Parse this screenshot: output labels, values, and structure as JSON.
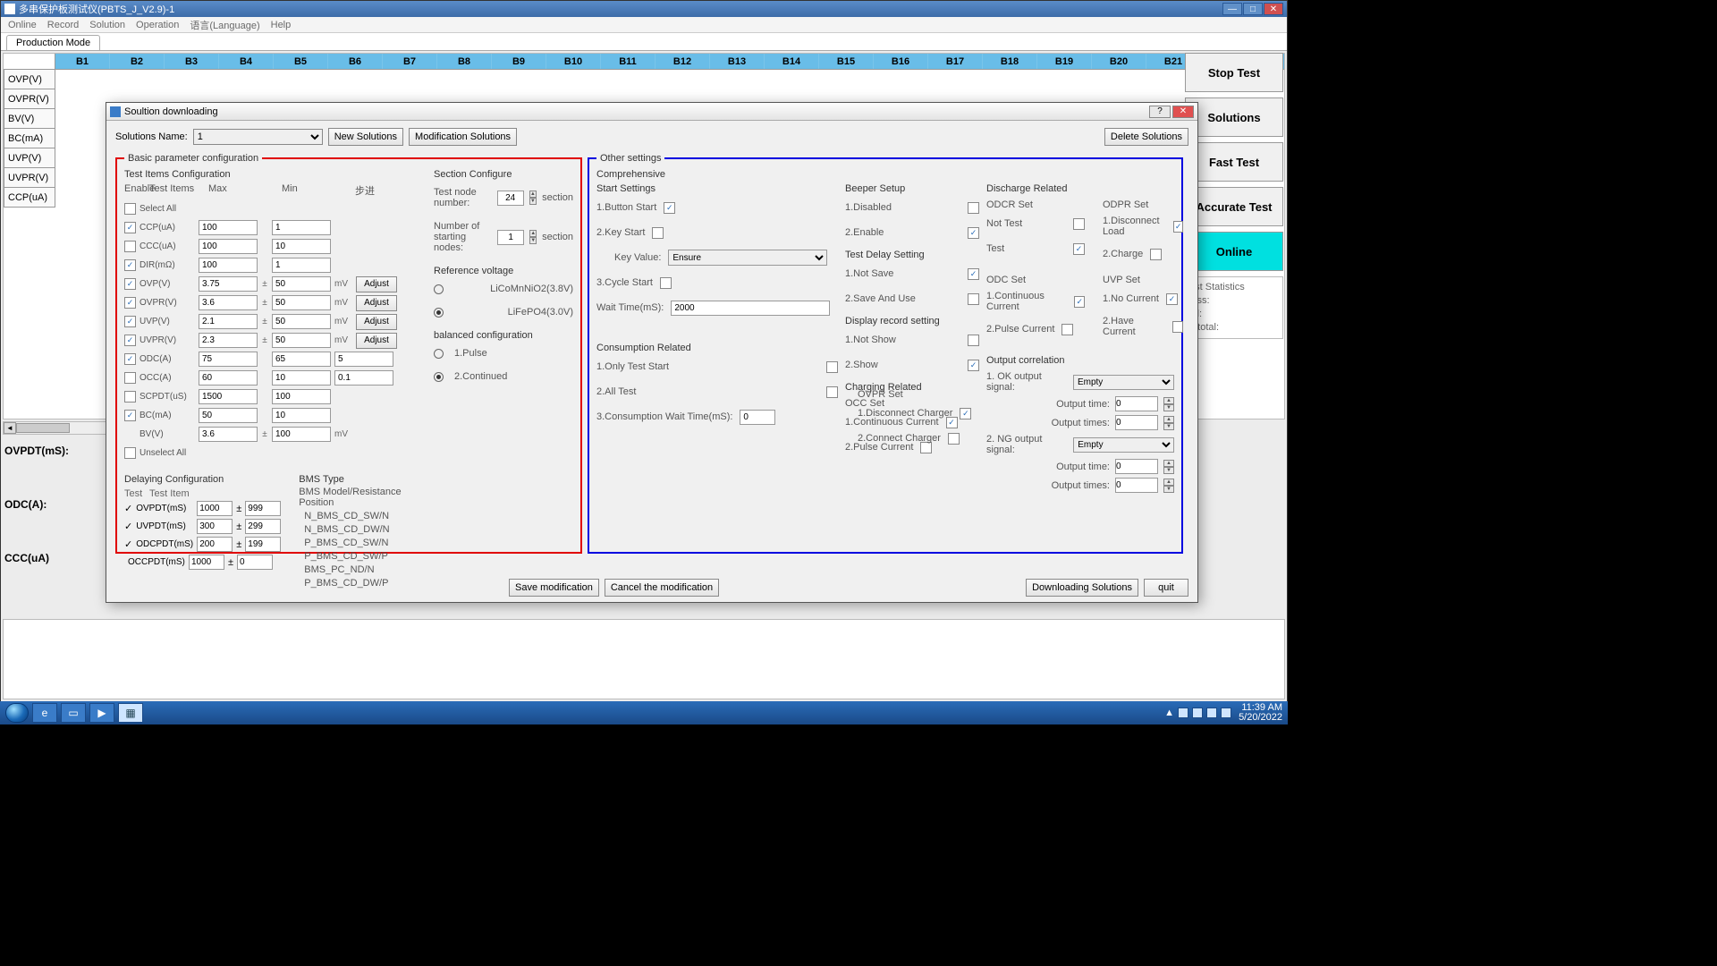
{
  "window": {
    "title": "多串保护板测试仪(PBTS_J_V2.9)-1"
  },
  "menu": [
    "Online",
    "Record",
    "Solution",
    "Operation",
    "语言(Language)",
    "Help"
  ],
  "tab": "Production Mode",
  "cols": [
    "B1",
    "B2",
    "B3",
    "B4",
    "B5",
    "B6",
    "B7",
    "B8",
    "B9",
    "B10",
    "B11",
    "B12",
    "B13",
    "B14",
    "B15",
    "B16",
    "B17",
    "B18",
    "B19",
    "B20",
    "B21"
  ],
  "rows": [
    "OVP(V)",
    "OVPR(V)",
    "BV(V)",
    "BC(mA)",
    "UVP(V)",
    "UVPR(V)",
    "CCP(uA)"
  ],
  "sideLabels": [
    "OVPDT(mS):",
    "ODC(A):",
    "CCC(uA)"
  ],
  "rightButtons": {
    "stop": "Stop Test",
    "solutions": "Solutions",
    "fast": "Fast Test",
    "accurate": "Accurate Test",
    "online": "Online"
  },
  "stats": {
    "title": "est Statistics",
    "pass": "lass:",
    "fail": "ail:",
    "total": "n total:"
  },
  "dialog": {
    "title": "Soultion downloading",
    "solutionsName": "Solutions Name:",
    "solutionValue": "1",
    "newSolutions": "New Solutions",
    "modifySolutions": "Modification Solutions",
    "deleteSolutions": "Delete Solutions",
    "basicLegend": "Basic parameter configuration",
    "ticTitle": "Test Items Configuration",
    "ticHead": {
      "enable": "Enable",
      "items": "Test Items",
      "max": "Max",
      "min": "Min",
      "step": "步进"
    },
    "selectAll": "Select All",
    "unselectAll": "Unselect All",
    "items": [
      {
        "on": true,
        "name": "CCP(uA)",
        "max": "100",
        "min": "1"
      },
      {
        "on": false,
        "name": "CCC(uA)",
        "max": "100",
        "min": "10"
      },
      {
        "on": true,
        "name": "DIR(mΩ)",
        "max": "100",
        "min": "1"
      },
      {
        "on": true,
        "name": "OVP(V)",
        "max": "3.75",
        "pm": true,
        "min": "50",
        "unit": "mV",
        "adj": true
      },
      {
        "on": true,
        "name": "OVPR(V)",
        "max": "3.6",
        "pm": true,
        "min": "50",
        "unit": "mV",
        "adj": true
      },
      {
        "on": true,
        "name": "UVP(V)",
        "max": "2.1",
        "pm": true,
        "min": "50",
        "unit": "mV",
        "adj": true
      },
      {
        "on": true,
        "name": "UVPR(V)",
        "max": "2.3",
        "pm": true,
        "min": "50",
        "unit": "mV",
        "adj": true
      },
      {
        "on": true,
        "name": "ODC(A)",
        "max": "75",
        "min": "65",
        "step": "5"
      },
      {
        "on": false,
        "name": "OCC(A)",
        "max": "60",
        "min": "10",
        "step": "0.1"
      },
      {
        "on": false,
        "name": "SCPDT(uS)",
        "max": "1500",
        "min": "100"
      },
      {
        "on": true,
        "name": "BC(mA)",
        "max": "50",
        "min": "10"
      },
      {
        "on": null,
        "name": "BV(V)",
        "max": "3.6",
        "pm": true,
        "min": "100",
        "unit": "mV"
      }
    ],
    "adjust": "Adjust",
    "sectionTitle": "Section  Configure",
    "testNode": "Test node number:",
    "testNodeVal": "24",
    "sectionWord": "section",
    "numStart": "Number of starting nodes:",
    "numStartVal": "1",
    "refVolt": "Reference voltage",
    "ref1": "LiCoMnNiO2(3.8V)",
    "ref2": "LiFePO4(3.0V)",
    "balCfg": "balanced configuration",
    "bal1": "1.Pulse",
    "bal2": "2.Continued",
    "delayTitle": "Delaying Configuration",
    "delayHead": {
      "test": "Test",
      "item": "Test Item"
    },
    "delays": [
      {
        "on": true,
        "name": "OVPDT(mS)",
        "a": "1000",
        "b": "999"
      },
      {
        "on": true,
        "name": "UVPDT(mS)",
        "a": "300",
        "b": "299"
      },
      {
        "on": true,
        "name": "ODCPDT(mS)",
        "a": "200",
        "b": "199"
      },
      {
        "on": false,
        "name": "OCCPDT(mS)",
        "a": "1000",
        "b": "0"
      }
    ],
    "bmsTitle": "BMS Type",
    "bmsSub": "BMS Model/Resistance Position",
    "bms": [
      {
        "sel": true,
        "name": "N_BMS_CD_SW/N"
      },
      {
        "sel": false,
        "name": "N_BMS_CD_DW/N"
      },
      {
        "sel": false,
        "name": "P_BMS_CD_SW/N"
      },
      {
        "sel": false,
        "name": "P_BMS_CD_SW/P"
      },
      {
        "sel": false,
        "name": "BMS_PC_ND/N"
      },
      {
        "sel": false,
        "name": "P_BMS_CD_DW/P"
      }
    ],
    "otherLegend": "Other settings",
    "comprehensive": "Comprehensive",
    "startSettings": "Start Settings",
    "start": {
      "btn": "1.Button Start",
      "key": "2.Key Start",
      "keyVal": "Key Value:",
      "keyCombo": "Ensure",
      "cycle": "3.Cycle Start",
      "wait": "Wait Time(mS):",
      "waitVal": "2000"
    },
    "consumption": "Consumption Related",
    "cons": {
      "only": "1.Only Test Start",
      "all": "2.All Test",
      "wait": "3.Consumption Wait Time(mS):",
      "waitVal": "0"
    },
    "beeper": "Beeper Setup",
    "beep": {
      "dis": "1.Disabled",
      "en": "2.Enable"
    },
    "testDelay": "Test Delay Setting",
    "tdel": {
      "ns": "1.Not Save",
      "su": "2.Save And Use"
    },
    "dispRec": "Display record setting",
    "drec": {
      "ns": "1.Not Show",
      "sh": "2.Show"
    },
    "charging": "Charging Related",
    "occSet": "OCC Set",
    "occ": {
      "cc": "1.Continuous Current",
      "pc": "2.Pulse Current"
    },
    "ovprSet": "OVPR Set",
    "ovpr": {
      "dc": "1.Disconnect Charger",
      "cc": "2.Connect Charger"
    },
    "discharge": "Discharge Related",
    "odcrSet": "ODCR Set",
    "odcr": {
      "nt": "Not Test",
      "t": "Test"
    },
    "odprSet": "ODPR Set",
    "odpr": {
      "dl": "1.Disconnect Load",
      "ch": "2.Charge"
    },
    "odcSet": "ODC Set",
    "odc": {
      "cc": "1.Continuous Current",
      "pc": "2.Pulse Current"
    },
    "uvpSet": "UVP Set",
    "uvp": {
      "nc": "1.No Current",
      "hc": "2.Have Current"
    },
    "outCorr": "Output correlation",
    "out": {
      "ok": "1. OK output signal:",
      "ng": "2. NG output signal:",
      "empty": "Empty",
      "otime": "Output time:",
      "otimes": "Output times:",
      "v0": "0"
    },
    "save": "Save modification",
    "cancel": "Cancel the modification",
    "download": "Downloading Solutions",
    "quit": "quit"
  },
  "taskbar": {
    "time": "11:39 AM",
    "date": "5/20/2022"
  }
}
